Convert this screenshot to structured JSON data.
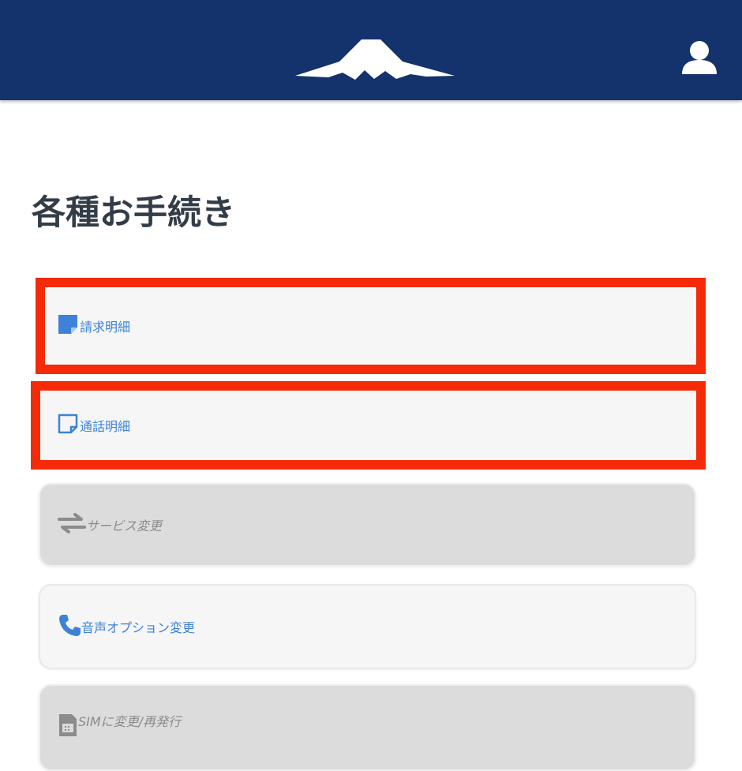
{
  "header": {
    "logo_icon": "mount-fuji-logo",
    "user_icon": "user-icon",
    "background_color": "#14326b"
  },
  "page": {
    "title": "各種お手続き"
  },
  "menu": {
    "items": [
      {
        "label": "請求明細",
        "icon": "note-filled-icon",
        "enabled": true,
        "highlighted": true
      },
      {
        "label": "通話明細",
        "icon": "note-outline-icon",
        "enabled": true,
        "highlighted": true
      },
      {
        "label": "サービス変更",
        "icon": "swap-arrows-icon",
        "enabled": false,
        "highlighted": false
      },
      {
        "label": "音声オプション変更",
        "icon": "phone-icon",
        "enabled": true,
        "highlighted": false
      },
      {
        "label": "SIMに変更/再発行",
        "icon": "sim-card-icon",
        "enabled": false,
        "highlighted": false
      }
    ]
  },
  "colors": {
    "highlight_frame": "#f52a08",
    "link_text": "#3d82d6",
    "disabled_text": "#8b8b8b",
    "title_text": "#333d48"
  }
}
